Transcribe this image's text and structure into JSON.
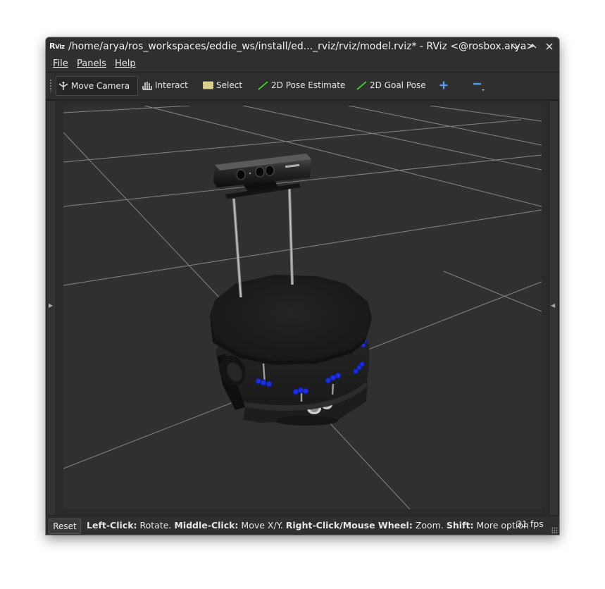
{
  "window": {
    "app_logo": "RViz",
    "title": "/home/arya/ros_workspaces/eddie_ws/install/ed..._rviz/rviz/model.rviz* - RViz <@rosbox.arya>"
  },
  "menu": {
    "file": "File",
    "panels": "Panels",
    "help": "Help"
  },
  "toolbar": {
    "move_camera": "Move Camera",
    "interact": "Interact",
    "select": "Select",
    "pose_estimate": "2D Pose Estimate",
    "goal_pose": "2D Goal Pose",
    "add_icon": "plus-icon",
    "remove_icon": "minus-icon"
  },
  "status": {
    "reset": "Reset",
    "left_click_key": "Left-Click:",
    "left_click_action": "Rotate.",
    "middle_click_key": "Middle-Click:",
    "middle_click_action": "Move X/Y.",
    "right_click_key": "Right-Click/Mouse Wheel:",
    "right_click_action": "Zoom.",
    "shift_key": "Shift:",
    "shift_action": "More option",
    "fps": "31 fps"
  },
  "colors": {
    "background": "#303030",
    "grid": "#a0a0a0",
    "sonar": "#1c2fd8",
    "pose_arrow": "#3fdc2a",
    "add_button": "#5aa0ff"
  }
}
